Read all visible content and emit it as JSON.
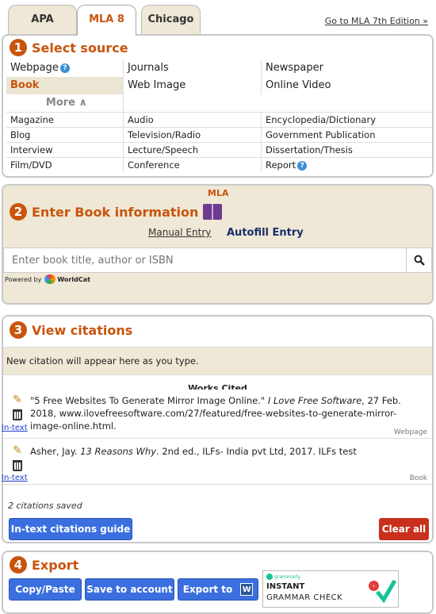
{
  "tabs": [
    {
      "label": "APA"
    },
    {
      "label": "MLA 8"
    },
    {
      "label": "Chicago"
    }
  ],
  "mla7_link": "Go to MLA 7th Edition »",
  "section1": {
    "number": "1",
    "title": "Select source",
    "top_rows": [
      [
        "Webpage",
        "Journals",
        "Newspaper"
      ],
      [
        "Book",
        "Web Image",
        "Online Video"
      ]
    ],
    "more_label": "More ∧",
    "more_rows": [
      [
        "Magazine",
        "Audio",
        "Encyclopedia/Dictionary"
      ],
      [
        "Blog",
        "Television/Radio",
        "Government Publication"
      ],
      [
        "Interview",
        "Lecture/Speech",
        "Dissertation/Thesis"
      ],
      [
        "Film/DVD",
        "Conference",
        "Report"
      ]
    ],
    "selected": "Book"
  },
  "section2": {
    "number": "2",
    "title": "Enter Book information",
    "style_tag": "MLA",
    "manual_label": "Manual Entry",
    "autofill_label": "Autofill Entry",
    "search_placeholder": "Enter book title, author or ISBN",
    "powered_by": "Powered by",
    "worldcat": "WorldCat"
  },
  "section3": {
    "number": "3",
    "title": "View citations",
    "new_citation_note": "New citation will appear here as you type.",
    "works_cited": "Works Cited",
    "citations": [
      {
        "text_before": "\"5 Free Websites To Generate Mirror Image Online.\" ",
        "italic": "I Love Free Software",
        "text_after": ", 27 Feb. 2018, www.ilovefreesoftware.com/27/featured/free-websites-to-generate-mirror-image-online.html.",
        "type": "Webpage",
        "intext_label": "In-text"
      },
      {
        "text_before": "Asher, Jay. ",
        "italic": "13 Reasons Why",
        "text_after": ". 2nd ed., ILFs- India pvt Ltd, 2017. ILFs test",
        "type": "Book",
        "intext_label": "In-text"
      }
    ],
    "saved_count": "2 citations saved",
    "guide_button": "In-text citations guide",
    "clear_button": "Clear all"
  },
  "section4": {
    "number": "4",
    "title": "Export",
    "copy_button": "Copy/Paste",
    "save_button": "Save to account",
    "export_button": "Export to",
    "word_icon_letter": "W",
    "ad": {
      "brand": "grammarly",
      "line1": "INSTANT",
      "line2": "GRAMMAR CHECK"
    }
  },
  "colors": {
    "accent": "#c8540d",
    "tan": "#efe8d6",
    "blue_button": "#3b6fe0",
    "red_button": "#c8301d"
  }
}
